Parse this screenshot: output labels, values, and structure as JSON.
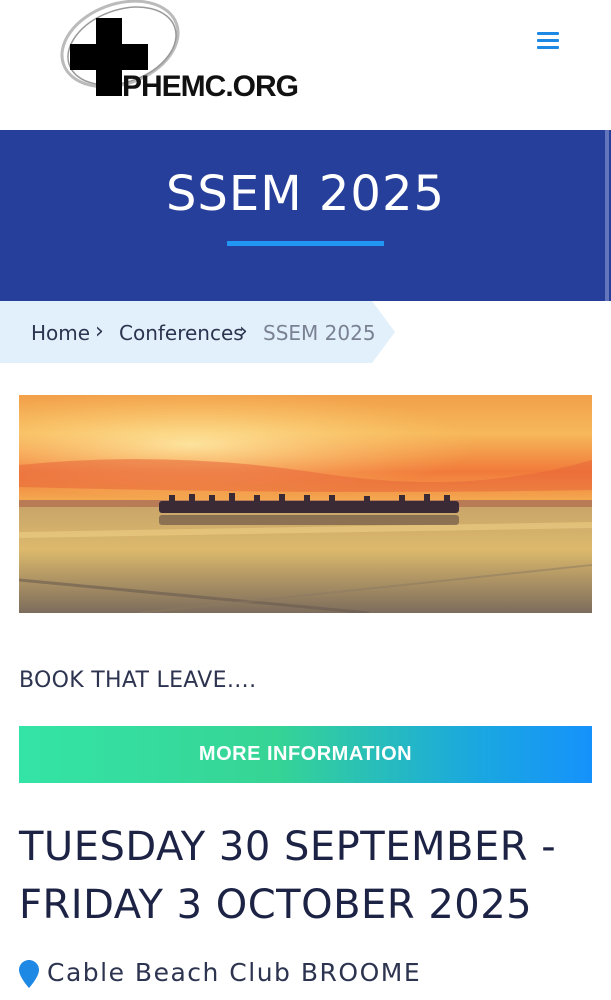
{
  "header": {
    "logo_text": "PHEMC.ORG",
    "menu_icon": "hamburger-menu-icon",
    "accent_color": "#1e88e5"
  },
  "banner": {
    "title": "SSEM 2025",
    "background_color": "#263f9a",
    "underline_color": "#2196f3"
  },
  "breadcrumb": {
    "items": [
      "Home",
      "Conferences",
      "SSEM 2025"
    ],
    "separator_icon": "chevron-right-icon"
  },
  "hero": {
    "description_icon": "camel-train-sunset-photo"
  },
  "content": {
    "lead_text": "BOOK THAT LEAVE….",
    "more_button_label": "MORE INFORMATION",
    "date_text": "TUESDAY 30 SEPTEMBER - FRIDAY 3 OCTOBER 2025",
    "venue_icon": "map-pin-icon",
    "venue_text": "Cable Beach Club BROOME"
  }
}
